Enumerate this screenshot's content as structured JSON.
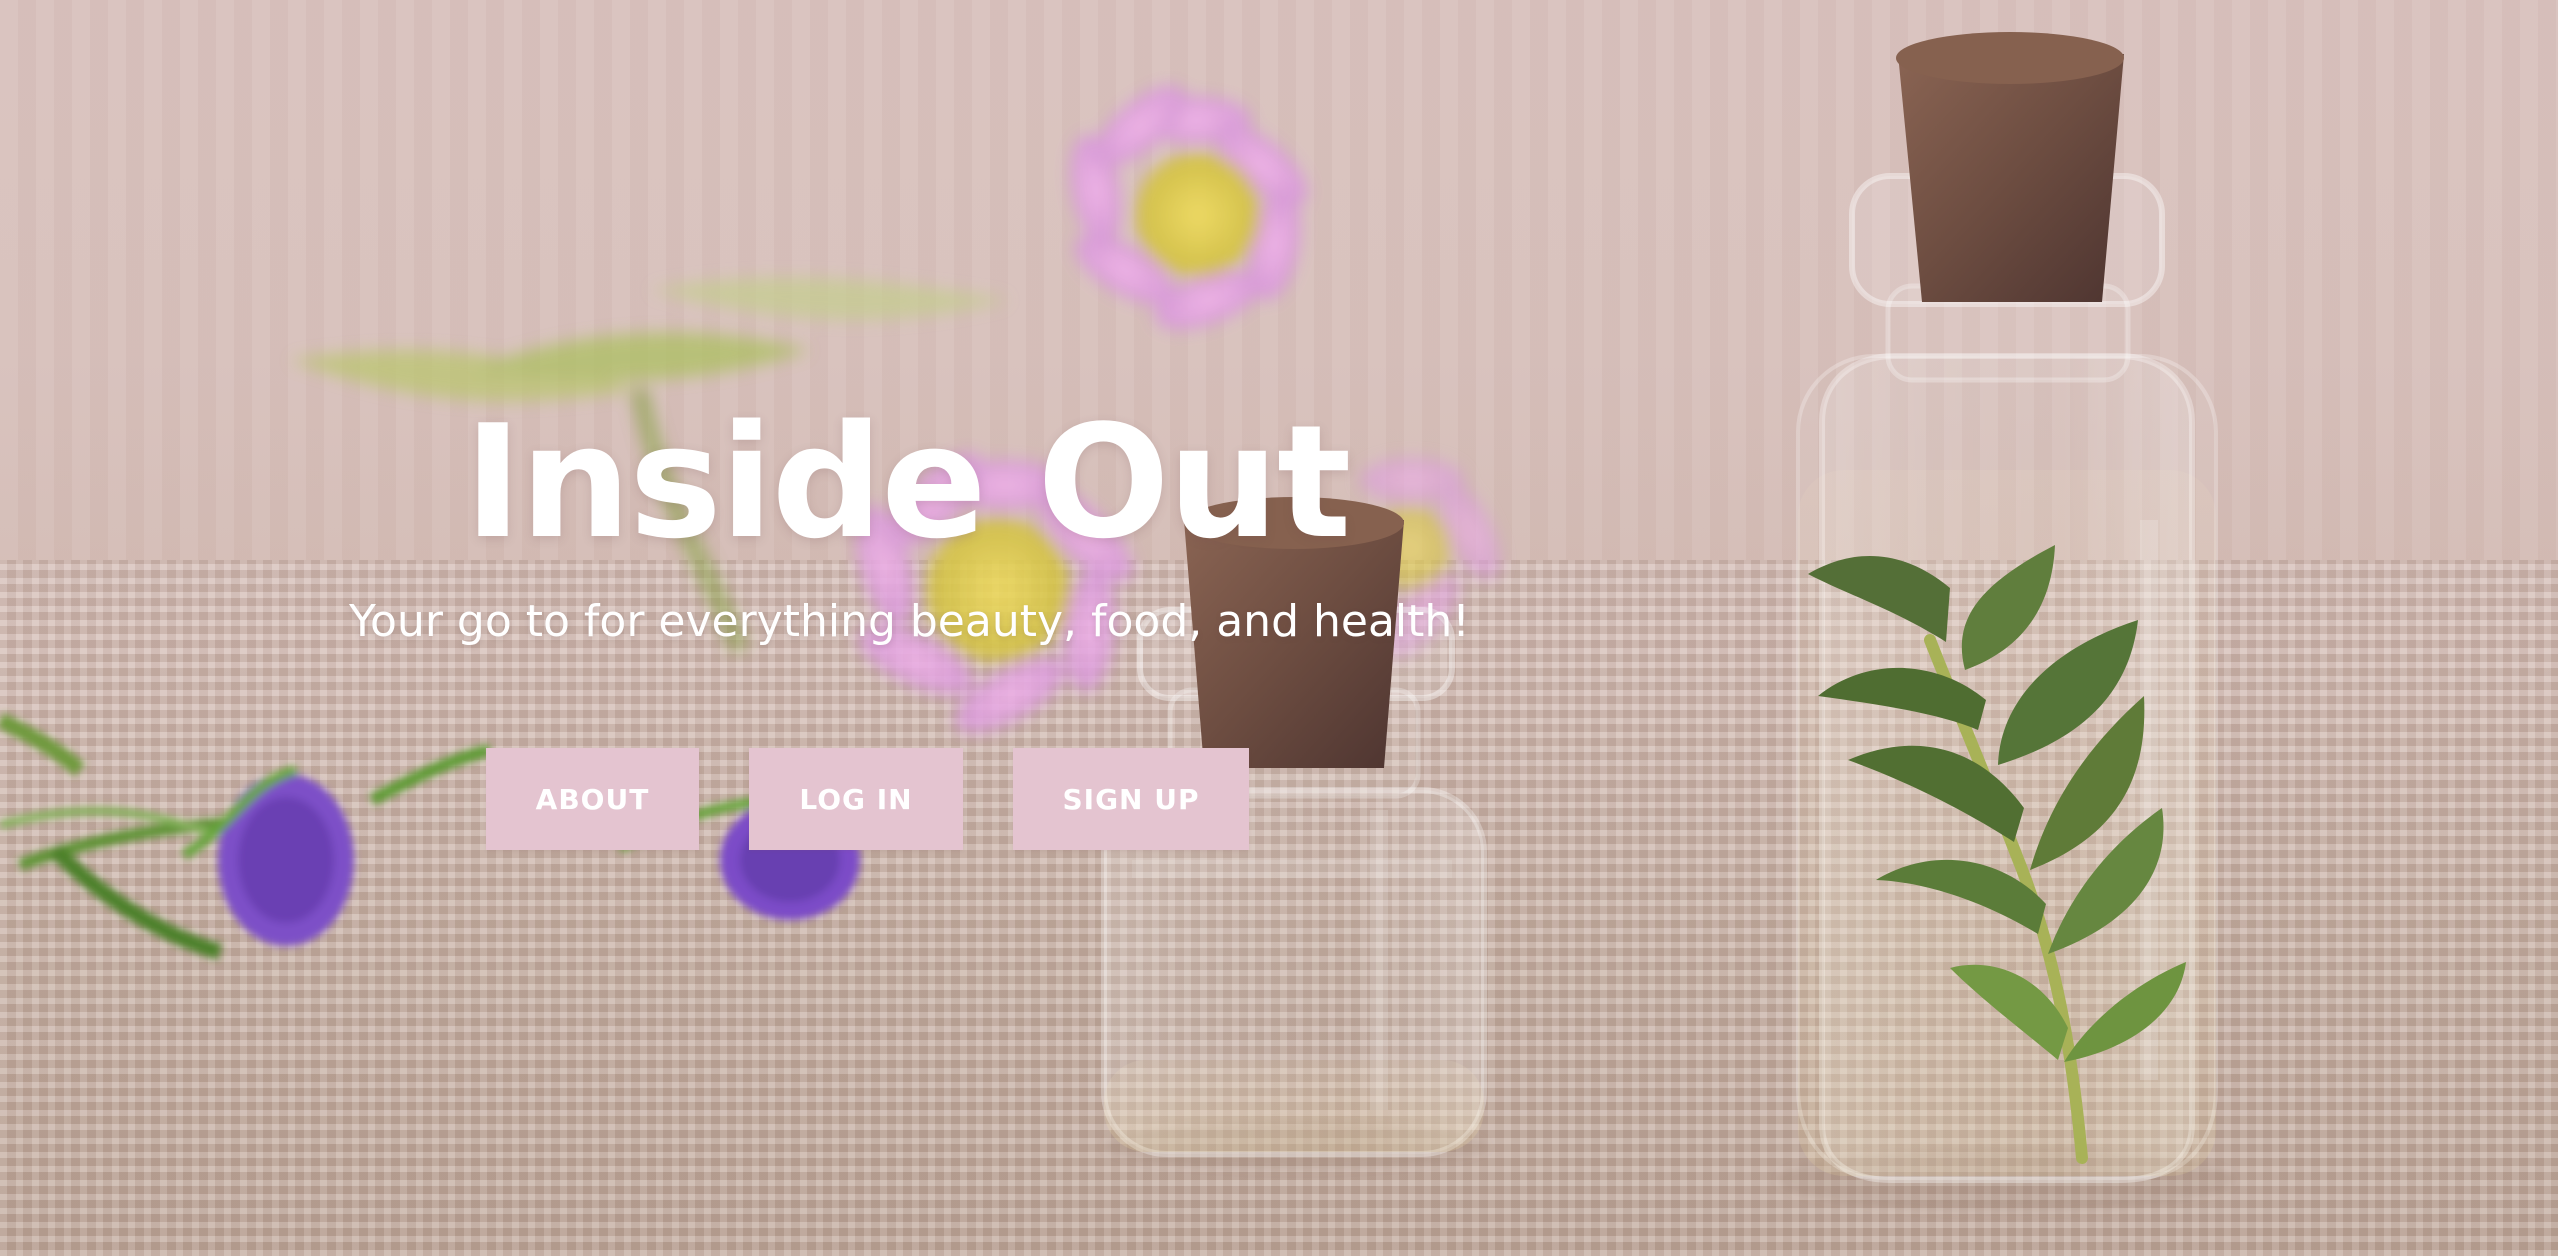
{
  "page": {
    "title": "Inside Out",
    "tagline": "Your go to for everything beauty, food, and health!"
  },
  "navigation": {
    "buttons": [
      {
        "label": "ABOUT"
      },
      {
        "label": "LOG IN"
      },
      {
        "label": "SIGN UP"
      }
    ]
  },
  "background": {
    "description_icons": [
      "flower-icon",
      "bottle-icon",
      "cork-icon",
      "leaf-icon",
      "burlap-fabric-icon"
    ],
    "colors": {
      "button_fill": "#e4c4d0",
      "title_text": "#ffffff",
      "tagline_text": "#ffffff",
      "fabric": "#d8c1bd",
      "flower_pink": "#d89bd5",
      "flower_center": "#e3cf4b",
      "thistle_purple": "#7d4fc7"
    }
  }
}
